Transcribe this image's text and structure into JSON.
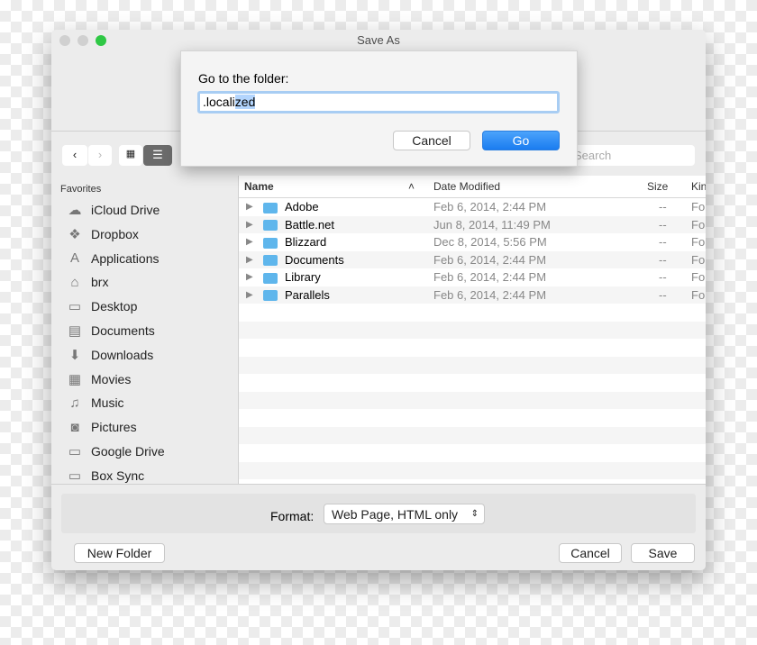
{
  "window": {
    "title": "Save As"
  },
  "toolbar": {
    "search_placeholder": "Search"
  },
  "sidebar": {
    "heading": "Favorites",
    "items": [
      {
        "label": "iCloud Drive",
        "icon": "cloud-icon",
        "glyph": "☁"
      },
      {
        "label": "Dropbox",
        "icon": "dropbox-icon",
        "glyph": "❖"
      },
      {
        "label": "Applications",
        "icon": "applications-icon",
        "glyph": "A"
      },
      {
        "label": "brx",
        "icon": "home-icon",
        "glyph": "⌂"
      },
      {
        "label": "Desktop",
        "icon": "desktop-icon",
        "glyph": "▭"
      },
      {
        "label": "Documents",
        "icon": "documents-icon",
        "glyph": "▤"
      },
      {
        "label": "Downloads",
        "icon": "downloads-icon",
        "glyph": "⬇"
      },
      {
        "label": "Movies",
        "icon": "movies-icon",
        "glyph": "▦"
      },
      {
        "label": "Music",
        "icon": "music-icon",
        "glyph": "♫"
      },
      {
        "label": "Pictures",
        "icon": "camera-icon",
        "glyph": "◙"
      },
      {
        "label": "Google Drive",
        "icon": "folder-icon",
        "glyph": "▭"
      },
      {
        "label": "Box Sync",
        "icon": "folder-icon",
        "glyph": "▭"
      }
    ]
  },
  "list": {
    "columns": {
      "name": "Name",
      "date": "Date Modified",
      "size": "Size",
      "kind": "Kind"
    },
    "rows": [
      {
        "name": "Adobe",
        "date": "Feb 6, 2014, 2:44 PM",
        "size": "--",
        "kind": "Folder"
      },
      {
        "name": "Battle.net",
        "date": "Jun 8, 2014, 11:49 PM",
        "size": "--",
        "kind": "Folder"
      },
      {
        "name": "Blizzard",
        "date": "Dec 8, 2014, 5:56 PM",
        "size": "--",
        "kind": "Folder"
      },
      {
        "name": "Documents",
        "date": "Feb 6, 2014, 2:44 PM",
        "size": "--",
        "kind": "Folder"
      },
      {
        "name": "Library",
        "date": "Feb 6, 2014, 2:44 PM",
        "size": "--",
        "kind": "Folder"
      },
      {
        "name": "Parallels",
        "date": "Feb 6, 2014, 2:44 PM",
        "size": "--",
        "kind": "Folder"
      }
    ]
  },
  "bottom": {
    "format_label": "Format:",
    "format_value": "Web Page, HTML only",
    "new_folder": "New Folder",
    "cancel": "Cancel",
    "save": "Save"
  },
  "dialog": {
    "prompt": "Go to the folder:",
    "value_plain": ".locali",
    "value_selected": "zed",
    "cancel": "Cancel",
    "go": "Go"
  }
}
